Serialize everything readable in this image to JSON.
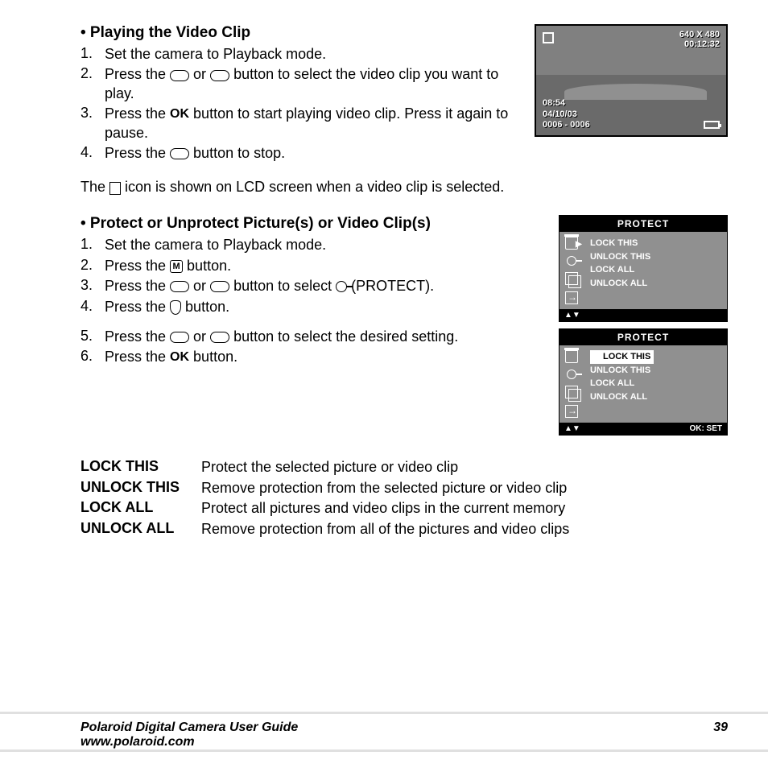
{
  "section1": {
    "title": "• Playing the Video Clip",
    "steps": [
      {
        "n": "1.",
        "t": "Set the camera to Playback mode."
      },
      {
        "n": "2.",
        "pre": "Press the ",
        "mid": " or ",
        "post": " button to select the video clip you want to play."
      },
      {
        "n": "3.",
        "pre": "Press the ",
        "ok": "OK",
        "post": " button to start playing video clip. Press it again to pause."
      },
      {
        "n": "4.",
        "pre": "Press the ",
        "post": " button to stop."
      }
    ],
    "note_pre": "The ",
    "note_post": " icon is shown on LCD screen when a video clip is selected."
  },
  "lcd": {
    "res": "640 X 480",
    "dur": "00:12:32",
    "time": "08:54",
    "date": "04/10/03",
    "count": "0006 - 0006"
  },
  "section2": {
    "title": "• Protect or Unprotect Picture(s) or Video Clip(s)",
    "s1": "Set the camera to Playback mode.",
    "s2_pre": "Press the ",
    "s2_post": " button.",
    "s3_pre": "Press the ",
    "s3_mid": " or ",
    "s3_post": " button to select ",
    "s3_end": " (PROTECT).",
    "s4_pre": "Press the ",
    "s4_post": " button.",
    "s5_pre": "Press the ",
    "s5_mid": " or ",
    "s5_post": " button to select the desired setting.",
    "s6_pre": "Press the ",
    "s6_ok": "OK",
    "s6_post": " button."
  },
  "menu": {
    "header": "PROTECT",
    "opts": [
      "LOCK THIS",
      "UNLOCK THIS",
      "LOCK ALL",
      "UNLOCK ALL"
    ],
    "footer_nav": "▲▼",
    "footer_ok": "OK:  SET"
  },
  "defs": [
    {
      "t": "LOCK THIS",
      "d": "Protect the selected picture or video clip"
    },
    {
      "t": "UNLOCK THIS",
      "d": "Remove protection from the selected picture or video clip"
    },
    {
      "t": "LOCK ALL",
      "d": "Protect all pictures and video clips in the current memory"
    },
    {
      "t": "UNLOCK ALL",
      "d": "Remove protection from all of the pictures and video clips"
    }
  ],
  "footer": {
    "title": "Polaroid Digital Camera User Guide",
    "url": "www.polaroid.com",
    "page": "39"
  }
}
